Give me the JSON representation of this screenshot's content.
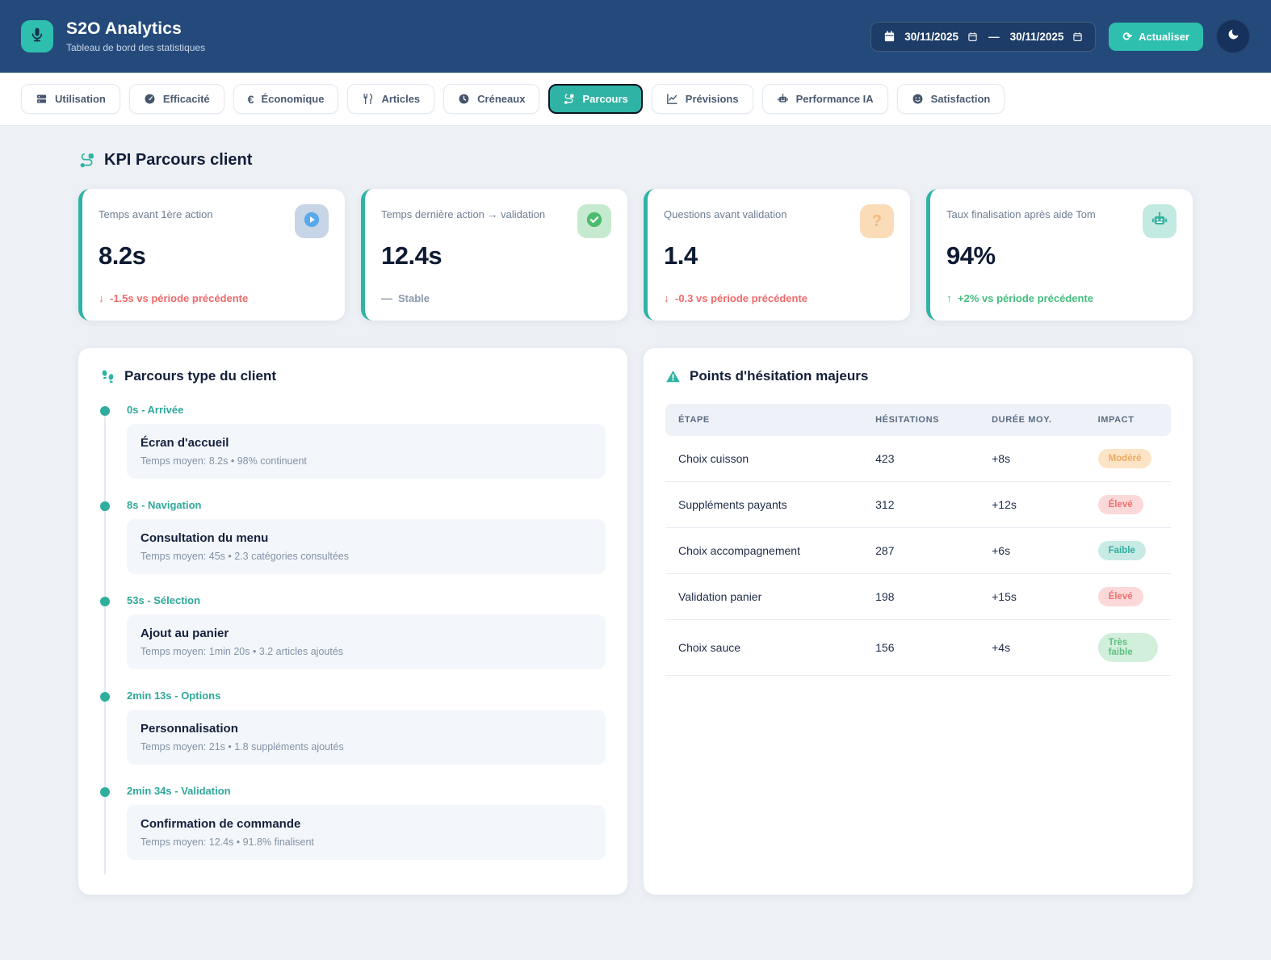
{
  "header": {
    "title": "S2O Analytics",
    "subtitle": "Tableau de bord des statistiques",
    "date_from": "30/11/2025",
    "date_to": "30/11/2025",
    "date_separator": "—",
    "refresh_label": "Actualiser",
    "logo_icon": "microphone-icon",
    "theme_toggle_icon": "moon-icon",
    "colors": {
      "header_bg": "#244a7c",
      "accent_teal": "#2fb3a4",
      "logo_bg": "#2fbfae"
    }
  },
  "tabs": [
    {
      "label": "Utilisation",
      "icon": "server",
      "active": false
    },
    {
      "label": "Efficacité",
      "icon": "gauge",
      "active": false
    },
    {
      "label": "Économique",
      "icon": "euro",
      "active": false
    },
    {
      "label": "Articles",
      "icon": "utensils",
      "active": false
    },
    {
      "label": "Créneaux",
      "icon": "clock",
      "active": false
    },
    {
      "label": "Parcours",
      "icon": "route",
      "active": true
    },
    {
      "label": "Prévisions",
      "icon": "chart-line",
      "active": false
    },
    {
      "label": "Performance IA",
      "icon": "robot",
      "active": false
    },
    {
      "label": "Satisfaction",
      "icon": "smiley",
      "active": false
    }
  ],
  "kpi_section": {
    "title": "KPI Parcours client",
    "title_icon": "route",
    "cards": [
      {
        "label": "Temps avant 1ère action",
        "value": "8.2s",
        "icon": "play",
        "icon_bg": "#c7d5e6",
        "icon_color": "#57a9ec",
        "trend_text": "-1.5s vs période précédente",
        "trend_dir": "down",
        "trend_color": "#ef6a6a"
      },
      {
        "label": "Temps dernière action → validation",
        "value": "12.4s",
        "icon": "check",
        "icon_bg": "#c6ead0",
        "icon_color": "#4dbb6f",
        "trend_text": "Stable",
        "trend_dir": "flat",
        "trend_color": "#8a99ad"
      },
      {
        "label": "Questions avant validation",
        "value": "1.4",
        "icon": "question",
        "icon_bg": "#fbdcb9",
        "icon_color": "#f3b97e",
        "trend_text": "-0.3 vs période précédente",
        "trend_dir": "down",
        "trend_color": "#ef6a6a"
      },
      {
        "label": "Taux finalisation après aide Tom",
        "value": "94%",
        "icon": "robot",
        "icon_bg": "#c2e9e2",
        "icon_color": "#36b2a1",
        "trend_text": "+2% vs période précédente",
        "trend_dir": "up",
        "trend_color": "#43bd7e"
      }
    ]
  },
  "journey_panel": {
    "title": "Parcours type du client",
    "title_icon": "footsteps",
    "steps": [
      {
        "time_label": "0s - Arrivée",
        "title": "Écran d'accueil",
        "meta": "Temps moyen: 8.2s • 98% continuent"
      },
      {
        "time_label": "8s - Navigation",
        "title": "Consultation du menu",
        "meta": "Temps moyen: 45s • 2.3 catégories consultées"
      },
      {
        "time_label": "53s - Sélection",
        "title": "Ajout au panier",
        "meta": "Temps moyen: 1min 20s • 3.2 articles ajoutés"
      },
      {
        "time_label": "2min 13s - Options",
        "title": "Personnalisation",
        "meta": "Temps moyen: 21s • 1.8 suppléments ajoutés"
      },
      {
        "time_label": "2min 34s - Validation",
        "title": "Confirmation de commande",
        "meta": "Temps moyen: 12.4s • 91.8% finalisent"
      }
    ]
  },
  "hesitation_panel": {
    "title": "Points d'hésitation majeurs",
    "title_icon": "warning",
    "columns": [
      "ÉTAPE",
      "HÉSITATIONS",
      "DURÉE MOY.",
      "IMPACT"
    ],
    "rows": [
      {
        "etape": "Choix cuisson",
        "hesitations": "423",
        "duree": "+8s",
        "impact": "Modéré",
        "impact_bg": "#fce4c7",
        "impact_color": "#f0ab62"
      },
      {
        "etape": "Suppléments payants",
        "hesitations": "312",
        "duree": "+12s",
        "impact": "Élevé",
        "impact_bg": "#fcd9d9",
        "impact_color": "#ef6f6f"
      },
      {
        "etape": "Choix accompagnement",
        "hesitations": "287",
        "duree": "+6s",
        "impact": "Faible",
        "impact_bg": "#c7eae5",
        "impact_color": "#2fae9e"
      },
      {
        "etape": "Validation panier",
        "hesitations": "198",
        "duree": "+15s",
        "impact": "Élevé",
        "impact_bg": "#fcd9d9",
        "impact_color": "#ef6f6f"
      },
      {
        "etape": "Choix sauce",
        "hesitations": "156",
        "duree": "+4s",
        "impact": "Très faible",
        "impact_bg": "#d2efdb",
        "impact_color": "#5fc083"
      }
    ]
  }
}
